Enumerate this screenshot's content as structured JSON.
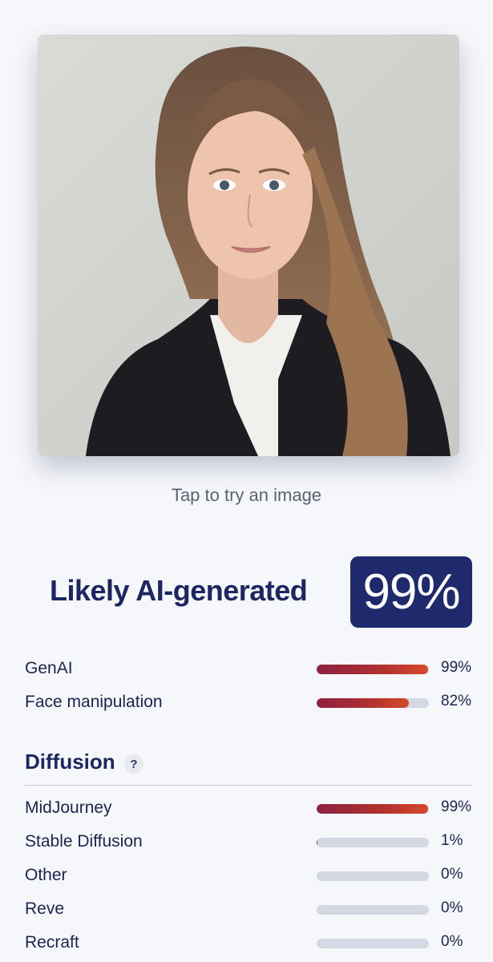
{
  "hint": "Tap to try an image",
  "verdict": {
    "label": "Likely AI-generated",
    "score": "99%"
  },
  "top_scores": [
    {
      "label": "GenAI",
      "value": 0.99,
      "pct": "99%"
    },
    {
      "label": "Face manipulation",
      "value": 0.82,
      "pct": "82%"
    }
  ],
  "diffusion": {
    "title": "Diffusion",
    "help": "?",
    "items": [
      {
        "label": "MidJourney",
        "value": 0.99,
        "pct": "99%"
      },
      {
        "label": "Stable Diffusion",
        "value": 0.01,
        "pct": "1%"
      },
      {
        "label": "Other",
        "value": 0.0,
        "pct": "0%"
      },
      {
        "label": "Reve",
        "value": 0.0,
        "pct": "0%"
      },
      {
        "label": "Recraft",
        "value": 0.0,
        "pct": "0%"
      }
    ]
  }
}
